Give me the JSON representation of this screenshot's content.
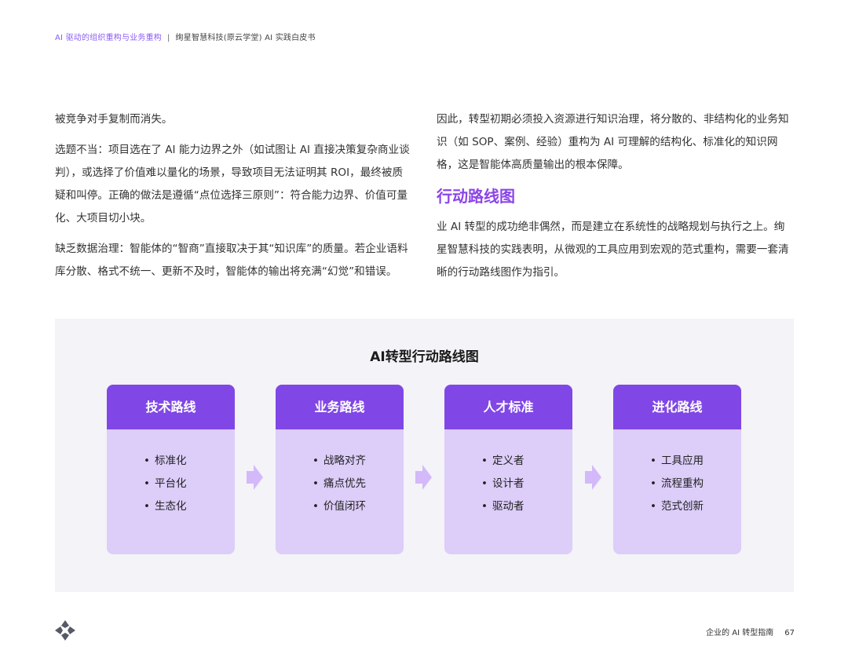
{
  "header": {
    "section": "AI 驱动的组织重构与业务重构",
    "separator": "|",
    "publication": "绚星智慧科技(原云学堂) AI 实践白皮书"
  },
  "left_column": {
    "paragraphs": [
      "被竞争对手复制而消失。",
      "选题不当：项目选在了 AI 能力边界之外（如试图让 AI 直接决策复杂商业谈判），或选择了价值难以量化的场景，导致项目无法证明其 ROI，最终被质疑和叫停。正确的做法是遵循“点位选择三原则”：符合能力边界、价值可量化、大项目切小块。",
      "缺乏数据治理：智能体的“智商”直接取决于其“知识库”的质量。若企业语料库分散、格式不统一、更新不及时，智能体的输出将充满“幻觉”和错误。"
    ]
  },
  "right_column": {
    "intro": "因此，转型初期必须投入资源进行知识治理，将分散的、非结构化的业务知识（如 SOP、案例、经验）重构为 AI 可理解的结构化、标准化的知识网格，这是智能体高质量输出的根本保障。",
    "section_title": "行动路线图",
    "body": "业 AI 转型的成功绝非偶然，而是建立在系统性的战略规划与执行之上。绚星智慧科技的实践表明，从微观的工具应用到宏观的范式重构，需要一套清晰的行动路线图作为指引。"
  },
  "figure": {
    "title": "AI转型行动路线图",
    "bullet": "•",
    "cards": [
      {
        "title": "技术路线",
        "items": [
          "标准化",
          "平台化",
          "生态化"
        ]
      },
      {
        "title": "业务路线",
        "items": [
          "战略对齐",
          "痛点优先",
          "价值闭环"
        ]
      },
      {
        "title": "人才标准",
        "items": [
          "定义者",
          "设计者",
          "驱动者"
        ]
      },
      {
        "title": "进化路线",
        "items": [
          "工具应用",
          "流程重构",
          "范式创新"
        ]
      }
    ],
    "colors": {
      "card_header": "#8047e6",
      "card_body": "#dccdf9",
      "arrow": "#d3b9fa",
      "background": "#f3f3f8"
    }
  },
  "footer": {
    "guide": "企业的 AI 转型指南",
    "page_number": "67"
  },
  "icons": {
    "logo": "brand-logo-icon",
    "arrow": "right-arrow-icon"
  }
}
